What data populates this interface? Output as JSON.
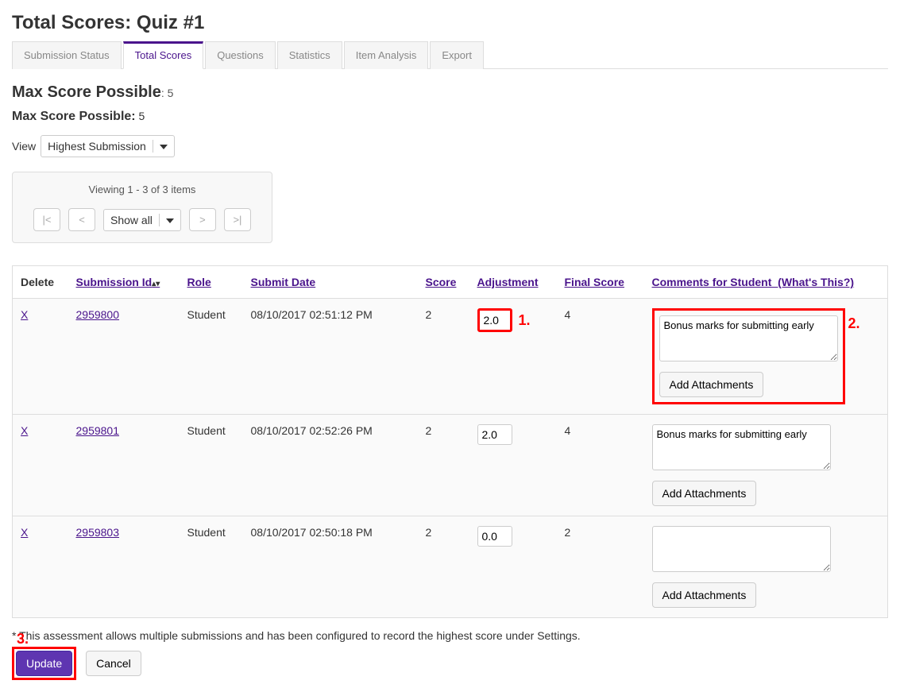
{
  "page_title": "Total Scores: Quiz #1",
  "tabs": [
    {
      "label": "Submission Status",
      "active": false
    },
    {
      "label": "Total Scores",
      "active": true
    },
    {
      "label": "Questions",
      "active": false
    },
    {
      "label": "Statistics",
      "active": false
    },
    {
      "label": "Item Analysis",
      "active": false
    },
    {
      "label": "Export",
      "active": false
    }
  ],
  "max_score_h2_label": "Max Score Possible",
  "max_score_h2_value": ": 5",
  "max_score_sub_label": "Max Score Possible:",
  "max_score_sub_value": "5",
  "view_label": "View",
  "view_select_value": "Highest Submission",
  "pager": {
    "status": "Viewing 1 - 3 of 3 items",
    "first": "|<",
    "prev": "<",
    "show_value": "Show all",
    "next": ">",
    "last": ">|"
  },
  "columns": {
    "delete": "Delete",
    "submission_id": "Submission Id",
    "role": "Role",
    "submit_date": "Submit Date",
    "score": "Score",
    "adjustment": "Adjustment",
    "final_score": "Final Score",
    "comments": "Comments for Student",
    "whats_this": "(What's This?)"
  },
  "rows": [
    {
      "delete": "X",
      "submission_id": "2959800",
      "role": "Student",
      "submit_date": "08/10/2017 02:51:12 PM",
      "score": "2",
      "adjustment": "2.0",
      "final_score": "4",
      "comment": "Bonus marks for submitting early",
      "attach_label": "Add Attachments"
    },
    {
      "delete": "X",
      "submission_id": "2959801",
      "role": "Student",
      "submit_date": "08/10/2017 02:52:26 PM",
      "score": "2",
      "adjustment": "2.0",
      "final_score": "4",
      "comment": "Bonus marks for submitting early",
      "attach_label": "Add Attachments"
    },
    {
      "delete": "X",
      "submission_id": "2959803",
      "role": "Student",
      "submit_date": "08/10/2017 02:50:18 PM",
      "score": "2",
      "adjustment": "0.0",
      "final_score": "2",
      "comment": "",
      "attach_label": "Add Attachments"
    }
  ],
  "callouts": {
    "one": "1.",
    "two": "2.",
    "three": "3."
  },
  "footer_note": "* This assessment allows multiple submissions and has been configured to record the highest score under Settings.",
  "update_label": "Update",
  "cancel_label": "Cancel",
  "sort_indicator": "▴▾"
}
